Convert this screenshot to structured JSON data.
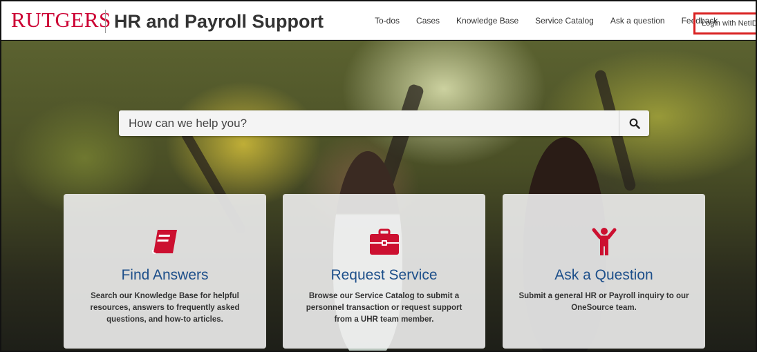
{
  "header": {
    "logo": "RUTGERS",
    "title": "HR and Payroll Support",
    "nav": [
      "To-dos",
      "Cases",
      "Knowledge Base",
      "Service Catalog",
      "Ask a question",
      "Feedback"
    ],
    "login": "Login with NetID"
  },
  "search": {
    "placeholder": "How can we help you?",
    "icon": "search-icon"
  },
  "cards": [
    {
      "icon": "book-icon",
      "title": "Find Answers",
      "desc": "Search our Knowledge Base for helpful resources, answers to frequently asked questions, and how-to articles."
    },
    {
      "icon": "briefcase-icon",
      "title": "Request Service",
      "desc": "Browse our Service Catalog to submit a personnel transaction or request support from a UHR team member."
    },
    {
      "icon": "person-raising-hand-icon",
      "title": "Ask a Question",
      "desc": "Submit a general HR or Payroll inquiry to our OneSource team."
    }
  ],
  "colors": {
    "brand_red": "#cc0033",
    "link_blue": "#1d4f8a",
    "highlight_red": "#d92020"
  }
}
